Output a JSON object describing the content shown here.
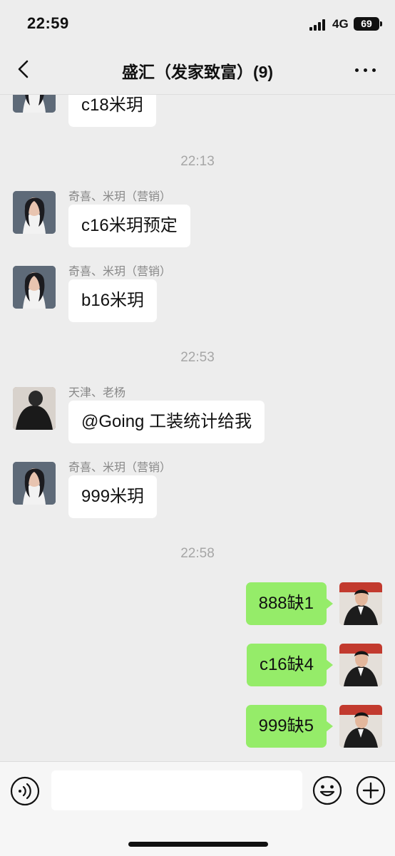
{
  "status_bar": {
    "time": "22:59",
    "network": "4G",
    "battery": "69"
  },
  "header": {
    "title": "盛汇（发家致富）(9)"
  },
  "messages": {
    "m0": {
      "text": "c18米玥"
    },
    "ts1": "22:13",
    "m1": {
      "sender": "奇喜、米玥（营销）",
      "text": "c16米玥预定"
    },
    "m2": {
      "sender": "奇喜、米玥（营销）",
      "text": "b16米玥"
    },
    "ts2": "22:53",
    "m3": {
      "sender": "天津、老杨",
      "text": "@Going 工装统计给我"
    },
    "m4": {
      "sender": "奇喜、米玥（营销）",
      "text": "999米玥"
    },
    "ts3": "22:58",
    "m5": {
      "text": "888缺1"
    },
    "m6": {
      "text": "c16缺4"
    },
    "m7": {
      "text": "999缺5"
    }
  },
  "input": {
    "value": "",
    "placeholder": ""
  },
  "icons": {
    "back": "chevron-left-icon",
    "more": "more-dots-icon",
    "voice": "voice-icon",
    "emoji": "emoji-icon",
    "plus": "plus-icon"
  },
  "colors": {
    "background": "#ededed",
    "outgoing_bubble": "#95ec69",
    "incoming_bubble": "#ffffff"
  }
}
